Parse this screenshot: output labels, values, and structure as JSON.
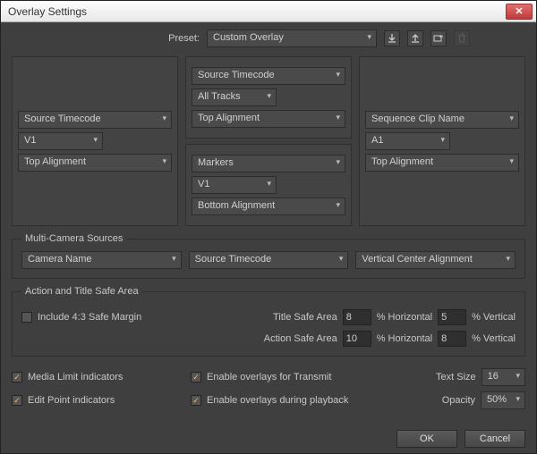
{
  "title": "Overlay Settings",
  "preset": {
    "label": "Preset:",
    "value": "Custom Overlay"
  },
  "cells": {
    "left": {
      "line1": "Source Timecode",
      "track": "V1",
      "align": "Top Alignment"
    },
    "top": {
      "line1": "Source Timecode",
      "track": "All Tracks",
      "align": "Top Alignment"
    },
    "bottom": {
      "line1": "Markers",
      "track": "V1",
      "align": "Bottom Alignment"
    },
    "right": {
      "line1": "Sequence Clip Name",
      "track": "A1",
      "align": "Top Alignment"
    }
  },
  "mc": {
    "legend": "Multi-Camera Sources",
    "a": "Camera Name",
    "b": "Source Timecode",
    "c": "Vertical Center Alignment"
  },
  "safe": {
    "legend": "Action and Title Safe Area",
    "include43": "Include 4:3 Safe Margin",
    "title_label": "Title Safe Area",
    "action_label": "Action Safe Area",
    "horiz": "% Horizontal",
    "vert": "% Vertical",
    "tH": "8",
    "tV": "5",
    "aH": "10",
    "aV": "8"
  },
  "opts": {
    "media_limit": "Media Limit indicators",
    "edit_point": "Edit Point indicators",
    "transmit": "Enable overlays for Transmit",
    "playback": "Enable overlays during playback",
    "text_size_label": "Text Size",
    "text_size": "16",
    "opacity_label": "Opacity",
    "opacity": "50%"
  },
  "btn": {
    "ok": "OK",
    "cancel": "Cancel"
  }
}
